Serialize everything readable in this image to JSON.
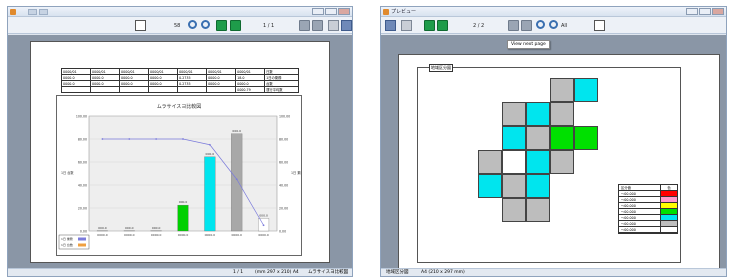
{
  "left_window": {
    "title": "ムラサイスヨ比較図",
    "toolbar": {
      "zoom_value": "58",
      "page_indicator": "1 / 1"
    },
    "status": {
      "page_info": "1 / 1",
      "paper": "(mm 297 x 210) A4",
      "document_name": "ムラサイスヨ比較図"
    },
    "table": {
      "rows": [
        [
          "0000/01",
          "0000/01",
          "0000/01",
          "0000/01",
          "0000/01",
          "0000/01",
          "0000/01",
          "日数"
        ],
        [
          "0000.0",
          "0000.0",
          "0000.0",
          "0000.0",
          "0.2735",
          "0000.0",
          "18.0",
          "1日の乗務"
        ],
        [
          "0000.0",
          "0000.0",
          "0000.0",
          "0000.0",
          "0.2735",
          "0000.0",
          "0000.0",
          "台数"
        ],
        [
          "",
          "",
          "",
          "",
          "",
          "",
          "0000.79",
          "運行平均数"
        ]
      ]
    },
    "chart_data": {
      "type": "bar",
      "title": "ムラサイスヨ比較図",
      "categories": [
        "0000.0",
        "0000.0",
        "0000.0",
        "0000.0",
        "0000.0",
        "0000.0",
        "0000.0"
      ],
      "values": [
        0.2,
        0.2,
        0.2,
        22.5,
        64.5,
        84.5,
        11.0
      ],
      "bar_colors": [
        "#ffffff",
        "#ffffff",
        "#ffffff",
        "#00d000",
        "#00e5ee",
        "#a8a8a8",
        "#ffffff"
      ],
      "value_labels": [
        "000.0",
        "000.0",
        "000.0",
        "000.0",
        "000.0",
        "000.0",
        "000.0"
      ],
      "line": {
        "color": "#7b7bdb",
        "values": [
          80,
          80,
          80,
          80,
          75,
          45,
          5
        ]
      },
      "y_ticks": [
        "100.00",
        "80.00",
        "60.00",
        "40.00",
        "20.00",
        "0.00"
      ],
      "ylim": [
        0,
        100
      ],
      "ylabel_left": "1日 台数",
      "ylabel_right": "1日 乗務",
      "legend": [
        {
          "label": "1日 乗務",
          "color": "#7b7bdb"
        },
        {
          "label": "1日 台数",
          "color": "#f0a040"
        }
      ]
    }
  },
  "right_window": {
    "title": "プレビュー",
    "toolbar": {
      "page_indicator": "2 / 2",
      "zoom_value": "All"
    },
    "tooltip": "View next page",
    "page_label": "地域区分図",
    "grid_colors": [
      "#bdbdbd",
      "#00e5ee",
      "#bdbdbd",
      "#00e5ee",
      "#bdbdbd",
      "#00e5ee",
      "#bdbdbd",
      "#00e000",
      "#00e000",
      "#bdbdbd",
      "#ffffff",
      "#00e5ee",
      "#bdbdbd",
      "#00e5ee",
      "#bdbdbd",
      "#00e5ee",
      "#bdbdbd",
      "#bdbdbd"
    ],
    "legend": {
      "header": {
        "label": "区分値",
        "value": "色"
      },
      "rows": [
        {
          "label": "〜00.000",
          "color": "#ff0000"
        },
        {
          "label": "〜00.000",
          "color": "#ff99cc"
        },
        {
          "label": "〜00.000",
          "color": "#ffff00"
        },
        {
          "label": "〜00.000",
          "color": "#00e000"
        },
        {
          "label": "〜00.000",
          "color": "#00e5ee"
        },
        {
          "label": "〜00.000",
          "color": "#bdbdbd"
        },
        {
          "label": "〜00.000",
          "color": "#ffffff"
        }
      ]
    },
    "status": {
      "document_name": "地域区分図",
      "paper": "A4 (210 x 297 mm)"
    }
  }
}
